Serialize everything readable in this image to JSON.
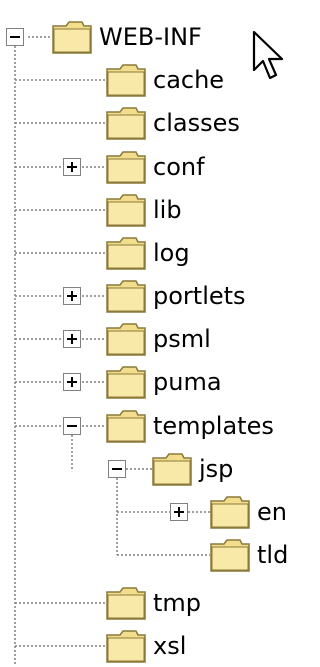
{
  "tree": {
    "root": {
      "label": "WEB-INF",
      "expanded": true
    },
    "items": [
      {
        "label": "cache",
        "has_children": false
      },
      {
        "label": "classes",
        "has_children": false
      },
      {
        "label": "conf",
        "has_children": true,
        "expanded": false
      },
      {
        "label": "lib",
        "has_children": false
      },
      {
        "label": "log",
        "has_children": false
      },
      {
        "label": "portlets",
        "has_children": true,
        "expanded": false
      },
      {
        "label": "psml",
        "has_children": true,
        "expanded": false
      },
      {
        "label": "puma",
        "has_children": true,
        "expanded": false
      },
      {
        "label": "templates",
        "has_children": true,
        "expanded": true
      },
      {
        "label": "jsp",
        "has_children": true,
        "expanded": true
      },
      {
        "label": "en",
        "has_children": true,
        "expanded": false
      },
      {
        "label": "tld",
        "has_children": false
      },
      {
        "label": "tmp",
        "has_children": false
      },
      {
        "label": "xsl",
        "has_children": false
      }
    ]
  },
  "icons": {
    "folder": "folder-icon",
    "expand": "plus-box-icon",
    "collapse": "minus-box-icon",
    "cursor": "mouse-pointer-icon"
  },
  "colors": {
    "folder_fill": "#f2dd8c",
    "folder_stroke": "#8a7a3a",
    "line": "#808080",
    "box_stroke": "#808080"
  }
}
